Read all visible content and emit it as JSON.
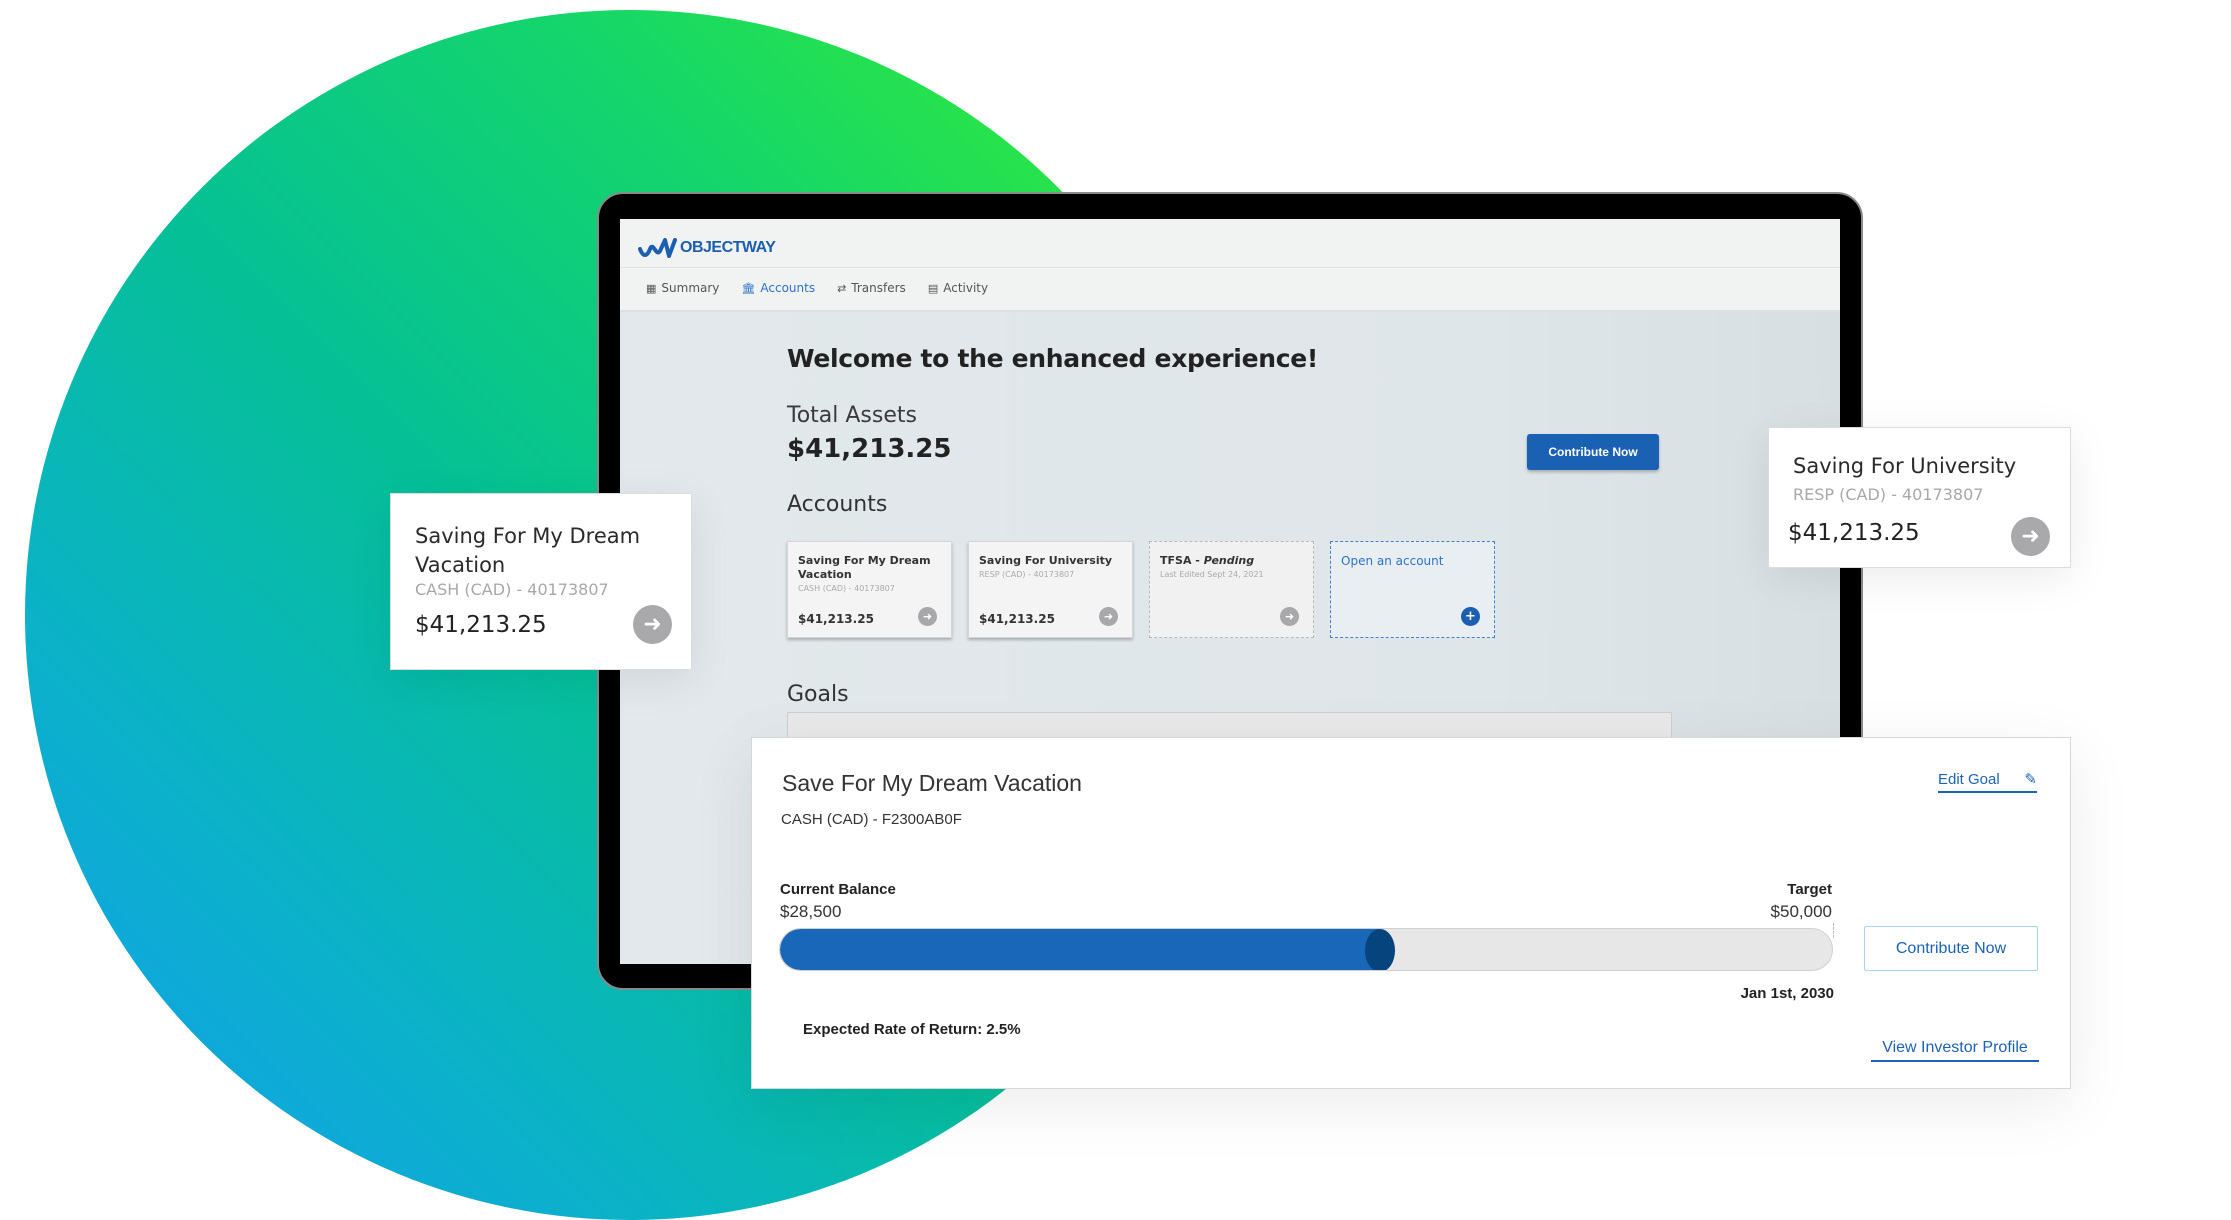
{
  "colors": {
    "brand_blue": "#1a61b4",
    "progress_fill": "#1867b9",
    "progress_knob": "#06447d",
    "link_blue": "#1a63b5"
  },
  "app": {
    "logo_text": "OBJECTWAY",
    "nav": [
      {
        "label": "Summary",
        "icon": "grid-icon",
        "active": false
      },
      {
        "label": "Accounts",
        "icon": "bank-icon",
        "active": true
      },
      {
        "label": "Transfers",
        "icon": "transfer-arrows-icon",
        "active": false
      },
      {
        "label": "Activity",
        "icon": "calendar-icon",
        "active": false
      }
    ]
  },
  "dashboard": {
    "welcome": "Welcome to the enhanced experience!",
    "total_assets_label": "Total Assets",
    "total_assets_value": "$41,213.25",
    "contribute_button": "Contribute Now",
    "accounts_label": "Accounts",
    "accounts": [
      {
        "title": "Saving For My Dream Vacation",
        "subtitle": "CASH (CAD) - 40173807",
        "amount": "$41,213.25"
      },
      {
        "title": "Saving For University",
        "subtitle": "RESP (CAD) - 40173807",
        "amount": "$41,213.25"
      },
      {
        "title_prefix": "TFSA - ",
        "title_status": "Pending",
        "subtitle": "Last Edited Sept 24, 2021"
      },
      {
        "title": "Open an account"
      }
    ],
    "goals_label": "Goals"
  },
  "floating_cards": {
    "left": {
      "title": "Saving For My Dream Vacation",
      "subtitle": "CASH (CAD) - 40173807",
      "amount": "$41,213.25"
    },
    "right": {
      "title": "Saving For University",
      "subtitle": "RESP (CAD) - 40173807",
      "amount": "$41,213.25"
    }
  },
  "goal_card": {
    "title": "Save For My Dream Vacation",
    "subtitle": "CASH (CAD) - F2300AB0F",
    "edit_label": "Edit Goal",
    "current_balance_label": "Current Balance",
    "current_balance_value": "$28,500",
    "target_label": "Target",
    "target_value": "$50,000",
    "progress_fraction": 0.57,
    "target_date": "Jan 1st, 2030",
    "contribute_button": "Contribute Now",
    "expected_return": "Expected Rate of Return: 2.5%",
    "view_profile_link": "View Investor Profile"
  }
}
